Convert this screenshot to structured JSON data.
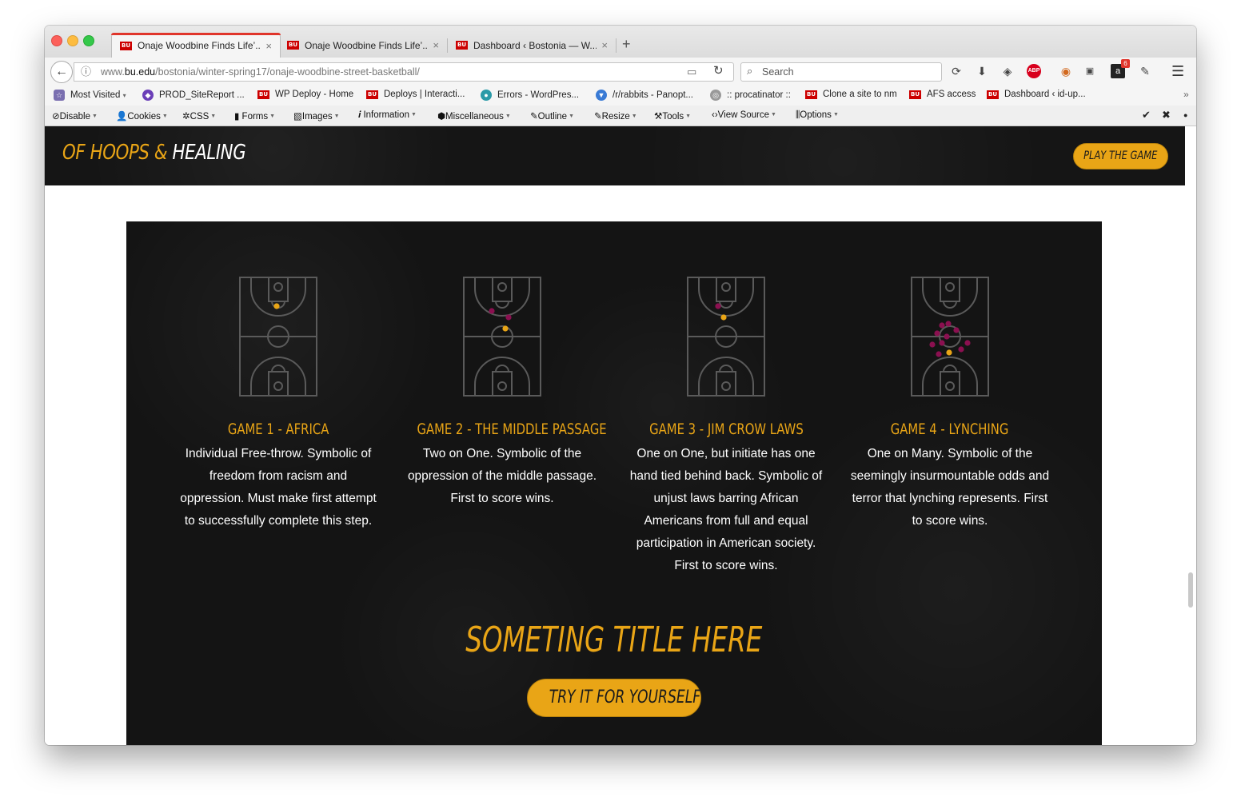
{
  "browser": {
    "tabs": [
      {
        "title": "Onaje Woodbine Finds Life’...",
        "badge": "BU"
      },
      {
        "title": "Onaje Woodbine Finds Life’...",
        "badge": "BU"
      },
      {
        "title": "Dashboard ‹ Bostonia — W...",
        "badge": "BU"
      }
    ],
    "new_tab": "+",
    "close_glyph": "×",
    "url": {
      "prefix": "www.",
      "domain": "bu.edu",
      "path": "/bostonia/winter-spring17/onaje-woodbine-street-basketball/"
    },
    "search_placeholder": "Search",
    "extension_badge_count": "6",
    "abp_label": "ABP"
  },
  "bookmarks": [
    {
      "label": "Most Visited",
      "caret": "▾"
    },
    {
      "label": "PROD_SiteReport ..."
    },
    {
      "label": "WP Deploy - Home"
    },
    {
      "label": "Deploys | Interacti..."
    },
    {
      "label": "Errors - WordPres..."
    },
    {
      "label": "/r/rabbits - Panopt..."
    },
    {
      "label": ":: procatinator ::"
    },
    {
      "label": "Clone a site to nm"
    },
    {
      "label": "AFS access"
    },
    {
      "label": "Dashboard ‹ id-up..."
    }
  ],
  "devtoolbar": [
    {
      "label": "Disable"
    },
    {
      "label": "Cookies"
    },
    {
      "label": "CSS"
    },
    {
      "label": "Forms"
    },
    {
      "label": "Images"
    },
    {
      "label": "Information"
    },
    {
      "label": "Miscellaneous"
    },
    {
      "label": "Outline"
    },
    {
      "label": "Resize"
    },
    {
      "label": "Tools"
    },
    {
      "label": "View Source"
    },
    {
      "label": "Options"
    }
  ],
  "site": {
    "brand_gold": "OF HOOPS & ",
    "brand_white": "HEALING",
    "play_button": "PLAY THE GAME"
  },
  "games": [
    {
      "title": "GAME 1 - AFRICA",
      "description": "Individual Free-throw. Symbolic of freedom from racism and oppression. Must make first attempt to successfully complete this step.",
      "players_gold": 1,
      "players_maroon": 0
    },
    {
      "title": "GAME 2 - THE MIDDLE PASSAGE",
      "description": "Two on One. Symbolic of the oppression of the middle passage. First to score wins.",
      "players_gold": 1,
      "players_maroon": 2
    },
    {
      "title": "GAME 3 - JIM CROW LAWS",
      "description": "One on One, but initiate has one hand tied behind back. Symbolic of unjust laws barring African Americans from full and equal participation in American society. First to score wins.",
      "players_gold": 1,
      "players_maroon": 1
    },
    {
      "title": "GAME 4 - LYNCHING",
      "description": "One on Many. Symbolic of the seemingly insurmountable odds and terror that lynching represents. First to score wins.",
      "players_gold": 1,
      "players_maroon": 10
    }
  ],
  "section": {
    "title": "SOMETING TITLE HERE",
    "cta": "TRY IT FOR YOURSELF"
  },
  "colors": {
    "accent_gold": "#e9a516",
    "maroon": "#8b1050",
    "panel_bg": "#141414",
    "court_lines": "#5a5a5a"
  }
}
